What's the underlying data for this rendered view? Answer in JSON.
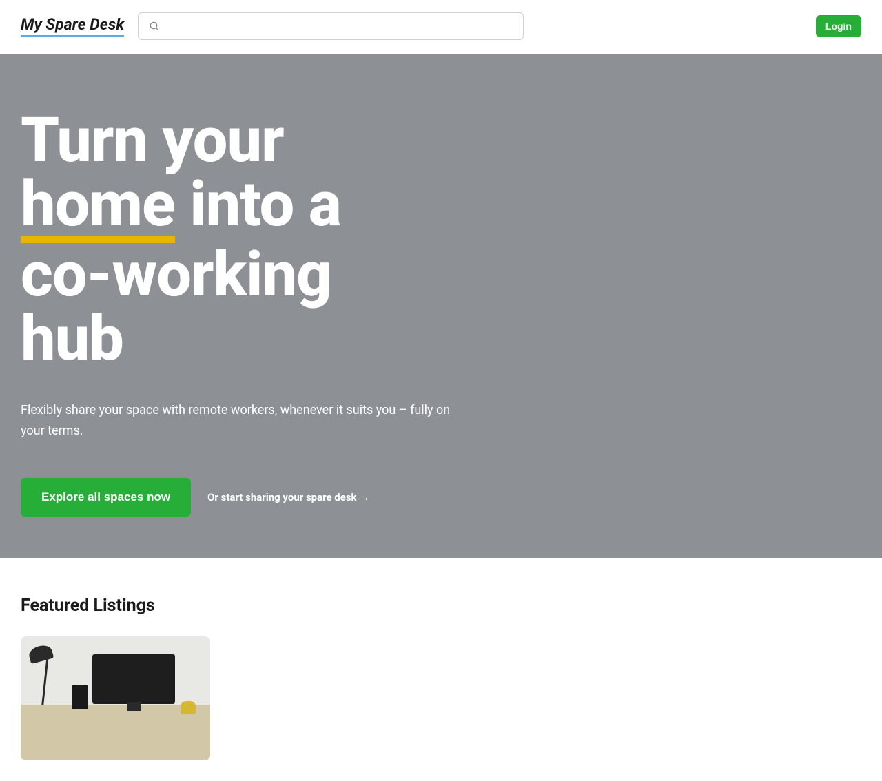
{
  "header": {
    "logo": "My Spare Desk",
    "search_placeholder": "",
    "login_label": "Login"
  },
  "hero": {
    "title_part1": "Turn your ",
    "title_underlined": "home",
    "title_part2": " into a co-working hub",
    "subtitle": "Flexibly share your space with remote workers, whenever it suits you – fully on your terms.",
    "explore_label": "Explore all spaces now",
    "share_link_label": "Or start sharing your spare desk →"
  },
  "featured": {
    "title": "Featured Listings"
  }
}
